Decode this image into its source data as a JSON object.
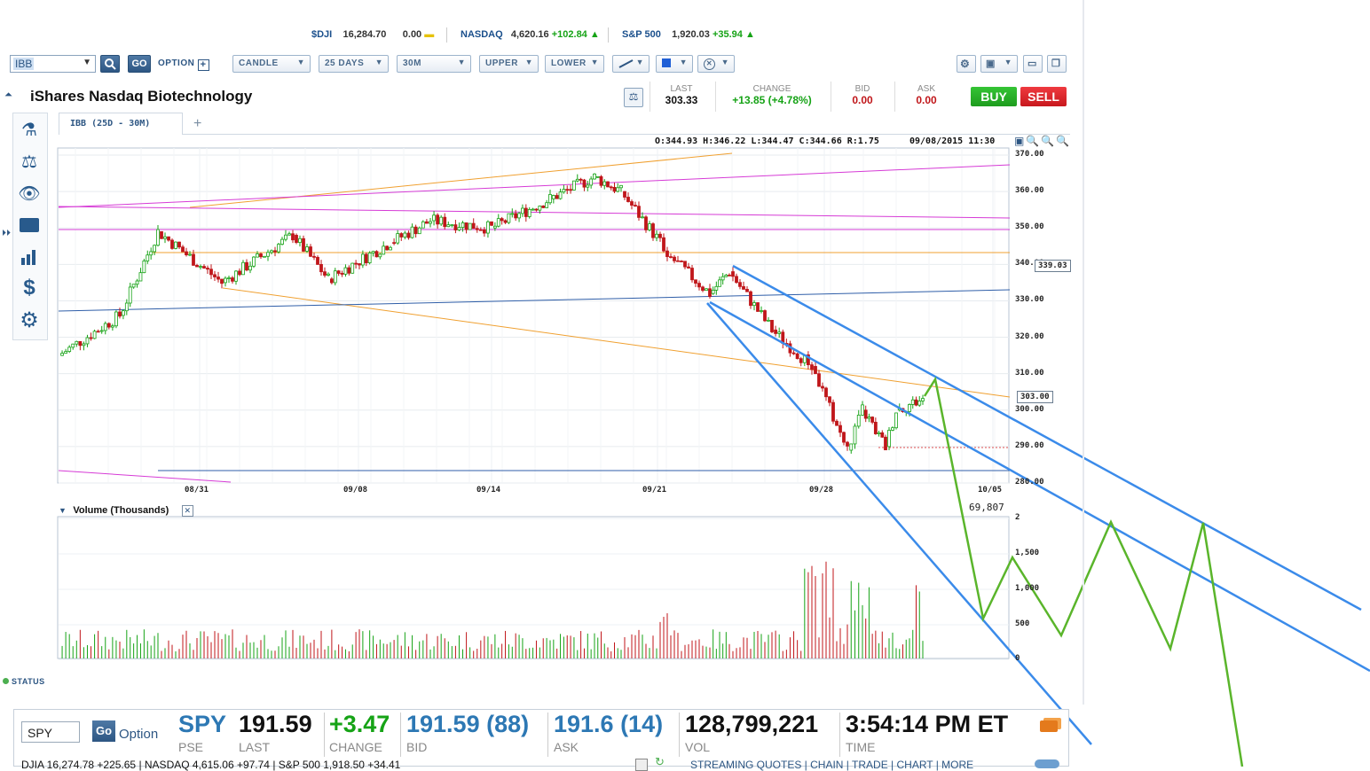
{
  "tickers": [
    {
      "label": "$DJI",
      "value": "16,284.70",
      "change": "0.00"
    },
    {
      "label": "NASDAQ",
      "value": "4,620.16",
      "change": "+102.84"
    },
    {
      "label": "S&P 500",
      "value": "1,920.03",
      "change": "+35.94"
    }
  ],
  "toolbar": {
    "symbol": "IBB",
    "go": "GO",
    "option": "OPTION",
    "chart_type": "CANDLE",
    "period": "25 DAYS",
    "interval": "30M",
    "upper": "UPPER",
    "lower": "LOWER"
  },
  "header": {
    "title": "iShares Nasdaq Biotechnology",
    "last_label": "LAST",
    "last": "303.33",
    "change_label": "CHANGE",
    "change": "+13.85 (+4.78%)",
    "bid_label": "BID",
    "bid": "0.00",
    "ask_label": "ASK",
    "ask": "0.00",
    "buy": "BUY",
    "sell": "SELL"
  },
  "chart_tab": "IBB (25D - 30M)",
  "chart_tab_add": "+",
  "ohlc_readout": "O:344.93 H:346.22 L:344.47 C:344.66 R:1.75",
  "timestamp": "09/08/2015 11:30",
  "price_tag_1": "339.03",
  "price_tag_2": "303.00",
  "volume_title": "Volume (Thousands)",
  "volume_readout": "69,807",
  "status": "STATUS",
  "quote_bar": {
    "symbol": "SPY",
    "go": "Go",
    "option": "Option",
    "symbol_big": "SPY",
    "last": "191.59",
    "last_label": "LAST",
    "source": "PSE",
    "change": "+3.47",
    "change_label": "CHANGE",
    "bid": "191.59 (88)",
    "bid_label": "BID",
    "ask": "191.6 (14)",
    "ask_label": "ASK",
    "vol": "128,799,221",
    "vol_label": "VOL",
    "time": "3:54:14 PM ET",
    "time_label": "TIME",
    "bottom_strip": "DJIA 16,274.78 +225.65  |  NASDAQ 4,615.06 +97.74  |  S&P 500 1,918.50 +34.41",
    "links": "STREAMING QUOTES | CHAIN | TRADE | CHART | MORE"
  },
  "colors": {
    "up": "#16a316",
    "down": "#c0161a",
    "accent": "#2d5683",
    "buy": "#1fa31f",
    "sell": "#d9262b",
    "channel": "#3b8bea",
    "projection": "#5ab52b"
  },
  "chart_data": {
    "type": "candlestick",
    "symbol": "IBB",
    "interval": "30M",
    "x_ticks": [
      "08/31",
      "09/08",
      "09/14",
      "09/21",
      "09/28",
      "10/05"
    ],
    "y_ticks": [
      280,
      290,
      300,
      310,
      320,
      330,
      340,
      350,
      360,
      370
    ],
    "ylim": [
      280,
      372
    ],
    "last_price": 303.0,
    "approx_close_path": [
      {
        "x": "start",
        "y": 315
      },
      {
        "x": "08/28",
        "y": 326
      },
      {
        "x": "08/31",
        "y": 349
      },
      {
        "x": "09/01",
        "y": 335
      },
      {
        "x": "09/03",
        "y": 348
      },
      {
        "x": "09/04",
        "y": 336
      },
      {
        "x": "09/08",
        "y": 346
      },
      {
        "x": "09/11",
        "y": 352
      },
      {
        "x": "09/14",
        "y": 350
      },
      {
        "x": "09/16",
        "y": 358
      },
      {
        "x": "09/17",
        "y": 364
      },
      {
        "x": "09/18",
        "y": 360
      },
      {
        "x": "09/21",
        "y": 341
      },
      {
        "x": "09/23",
        "y": 332
      },
      {
        "x": "09/24",
        "y": 338
      },
      {
        "x": "09/25",
        "y": 322
      },
      {
        "x": "09/28",
        "y": 312
      },
      {
        "x": "09/29",
        "y": 289
      },
      {
        "x": "09/30",
        "y": 300
      },
      {
        "x": "10/01",
        "y": 290
      },
      {
        "x": "10/02",
        "y": 300
      },
      {
        "x": "10/05",
        "y": 303
      }
    ],
    "volume_ticks": [
      "2",
      "1,500",
      "1,000",
      "500",
      "0"
    ]
  }
}
